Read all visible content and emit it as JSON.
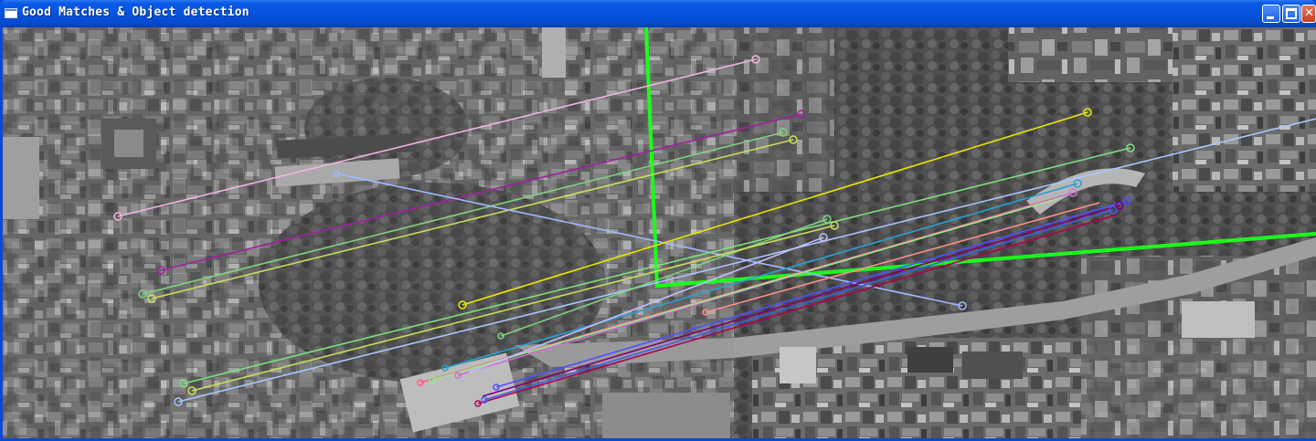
{
  "window": {
    "title": "Good Matches & Object detection",
    "icon": "app-window-icon",
    "controls": {
      "minimize": "minimize-icon",
      "maximize": "maximize-icon",
      "close": "close-icon",
      "close_glyph": "✕"
    }
  },
  "image": {
    "description_tag": "aerial-grayscale-matches",
    "left_image": "aerial-query-image",
    "right_image": "aerial-scene-image"
  },
  "colors": {
    "titlebar": "#0753de",
    "detection_box": "#1aff1a",
    "match_colors": [
      "#f4b4e0",
      "#a020a0",
      "#7fd27f",
      "#c8e05a",
      "#a0b8ff",
      "#e8e800",
      "#7fe07f",
      "#a8c8ff",
      "#2a9fd6",
      "#d070d0",
      "#5050ff",
      "#ff6080",
      "#b00050",
      "#90ee90",
      "#c0c0ff"
    ]
  }
}
